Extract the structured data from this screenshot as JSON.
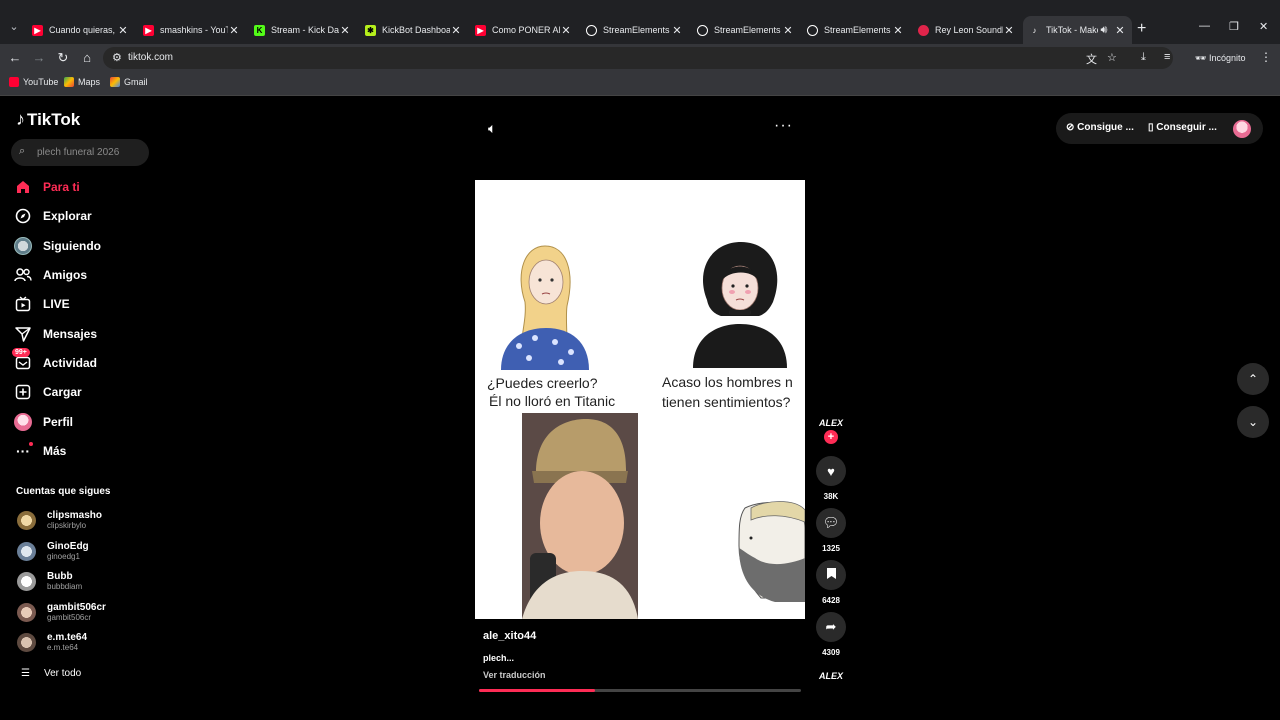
{
  "browser": {
    "tabs": [
      {
        "title": "Cuando quieras, c",
        "favicon": "youtube-icon",
        "color": "#ff0033"
      },
      {
        "title": "smashkins - YouTu",
        "favicon": "youtube-icon",
        "color": "#ff0033"
      },
      {
        "title": "Stream - Kick Das",
        "favicon": "kick-icon",
        "color": "#53fc18"
      },
      {
        "title": "KickBot Dashboar",
        "favicon": "kickbot-icon",
        "color": "#b6f01c"
      },
      {
        "title": "Como PONER ALE",
        "favicon": "youtube-icon",
        "color": "#ff0033"
      },
      {
        "title": "StreamElements -",
        "favicon": "streamelements-icon",
        "color": "#ffffff"
      },
      {
        "title": "StreamElements -",
        "favicon": "streamelements-icon",
        "color": "#ffffff"
      },
      {
        "title": "StreamElements -",
        "favicon": "streamelements-icon",
        "color": "#ffffff"
      },
      {
        "title": "Rey Leon Soundb",
        "favicon": "soundboard-icon",
        "color": "#e0244a"
      },
      {
        "title": "TikTok - Make",
        "favicon": "tiktok-icon",
        "color": "#ffffff"
      }
    ],
    "url": "tiktok.com",
    "incognito_label": "Incógnito",
    "bookmarks": [
      {
        "label": "YouTube",
        "color": "#ff0033"
      },
      {
        "label": "Maps",
        "color": "#34a853"
      },
      {
        "label": "Gmail",
        "color": "#ea4335"
      }
    ]
  },
  "tiktok": {
    "brand": "TikTok",
    "search_placeholder": "plech funeral 2026",
    "nav": [
      {
        "label": "Para ti",
        "icon": "home-icon"
      },
      {
        "label": "Explorar",
        "icon": "compass-icon"
      },
      {
        "label": "Siguiendo",
        "icon": "following-avatar-icon"
      },
      {
        "label": "Amigos",
        "icon": "friends-icon"
      },
      {
        "label": "LIVE",
        "icon": "live-icon"
      },
      {
        "label": "Mensajes",
        "icon": "send-icon"
      },
      {
        "label": "Actividad",
        "icon": "inbox-icon",
        "badge": "99+"
      },
      {
        "label": "Cargar",
        "icon": "upload-icon"
      },
      {
        "label": "Perfil",
        "icon": "profile-avatar-icon"
      },
      {
        "label": "Más",
        "icon": "more-icon"
      }
    ],
    "following_title": "Cuentas que sigues",
    "following": [
      {
        "name": "clipsmasho",
        "handle": "clipskirbylo"
      },
      {
        "name": "GinoEdg",
        "handle": "ginoedg1"
      },
      {
        "name": "Bubb",
        "handle": "bubbdiam"
      },
      {
        "name": "gambit506cr",
        "handle": "gambit506cr"
      },
      {
        "name": "e.m.te64",
        "handle": "e.m.te64"
      }
    ],
    "see_all": "Ver todo",
    "top_buttons": {
      "coins": "Consigue ...",
      "app": "Conseguir ..."
    },
    "video": {
      "meme_left": "¿Puedes creerlo?\nÉl no lloró en Titanic",
      "meme_left_1": "¿Puedes creerlo?",
      "meme_left_2": "Él no lloró en Titanic",
      "meme_right_1": "Acaso los hombres n",
      "meme_right_2": "tienen sentimientos?",
      "username": "ale_xito44",
      "caption": "plech...",
      "translate": "Ver traducción",
      "progress": 0.36
    },
    "author_badge": "ALEX",
    "actions": {
      "likes": "38K",
      "comments": "1325",
      "saves": "6428",
      "shares": "4309"
    },
    "accent": "#fe2c55"
  }
}
